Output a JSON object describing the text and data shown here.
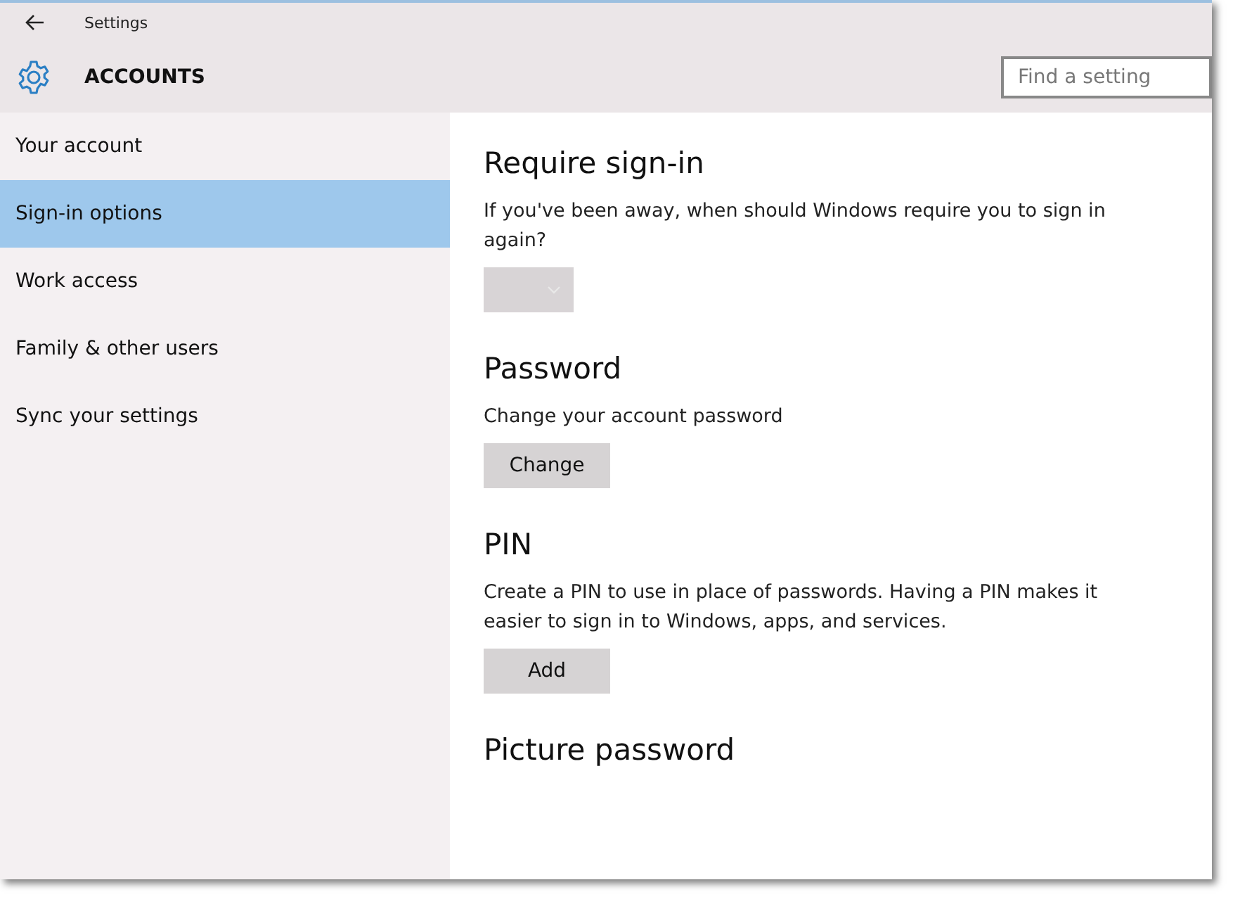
{
  "window": {
    "title": "Settings"
  },
  "header": {
    "title": "ACCOUNTS",
    "search": {
      "placeholder": "Find a setting"
    }
  },
  "sidebar": {
    "items": [
      {
        "label": "Your account",
        "selected": false
      },
      {
        "label": "Sign-in options",
        "selected": true
      },
      {
        "label": "Work access",
        "selected": false
      },
      {
        "label": "Family & other users",
        "selected": false
      },
      {
        "label": "Sync your settings",
        "selected": false
      }
    ]
  },
  "sections": [
    {
      "title": "Require sign-in",
      "description": "If you've been away, when should Windows require you to sign in again?",
      "control": {
        "kind": "dropdown",
        "disabled": true
      }
    },
    {
      "title": "Password",
      "description": "Change your account password",
      "control": {
        "kind": "button",
        "label": "Change"
      }
    },
    {
      "title": "PIN",
      "description": "Create a PIN to use in place of passwords. Having a PIN makes it easier to sign in to Windows, apps, and services.",
      "control": {
        "kind": "button",
        "label": "Add"
      }
    },
    {
      "title": "Picture password"
    }
  ]
}
